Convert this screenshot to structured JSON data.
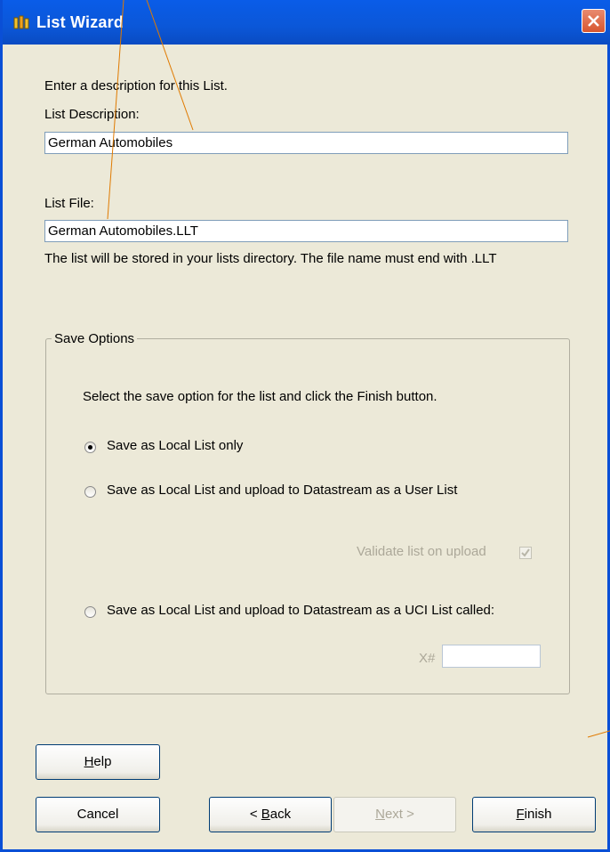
{
  "window": {
    "title": "List Wizard",
    "accent_color": "#0a4fd6",
    "close_icon": "close-icon"
  },
  "intro_text": "Enter a description for this List.",
  "description": {
    "label": "List Description:",
    "value": "German Automobiles"
  },
  "file": {
    "label": "List File:",
    "value": "German Automobiles.LLT",
    "note": "The list will be stored in your lists directory.  The file name must end with .LLT"
  },
  "save_options": {
    "legend": "Save Options",
    "instruction": "Select the save option for the list and click the Finish button.",
    "option_local": "Save as Local List only",
    "option_user": "Save as Local List and upload to Datastream as a User List",
    "validate_label": "Validate list on upload",
    "validate_checked": true,
    "option_uci": "Save as Local List and upload to Datastream as a UCI List called:",
    "uci_prefix": "X#",
    "uci_value": "",
    "selected": "local"
  },
  "buttons": {
    "help_hotkey": "H",
    "help_rest": "elp",
    "cancel": "Cancel",
    "back_prefix": "< ",
    "back_hotkey": "B",
    "back_rest": "ack",
    "next_hotkey": "N",
    "next_rest": "ext >",
    "finish_hotkey": "F",
    "finish_rest": "inish"
  }
}
